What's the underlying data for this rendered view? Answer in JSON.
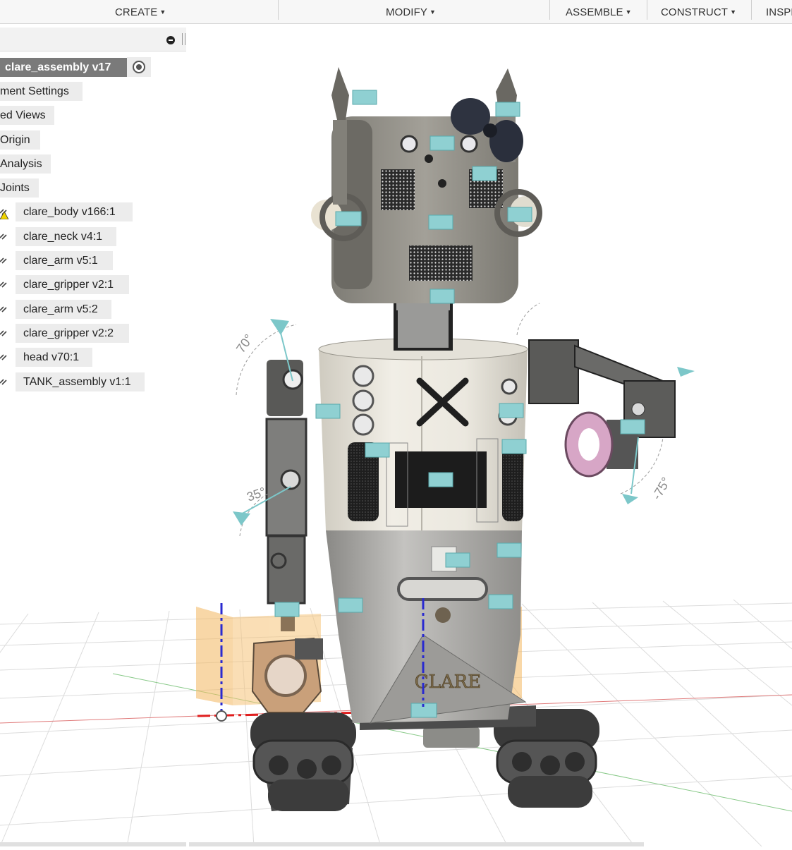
{
  "toolbar": {
    "create": "CREATE",
    "modify": "MODIFY",
    "assemble": "ASSEMBLE",
    "construct": "CONSTRUCT",
    "inspect": "INSPE"
  },
  "browser": {
    "root": "clare_assembly v17",
    "folders": [
      "ment Settings",
      "ed Views",
      "Origin",
      "Analysis",
      "Joints"
    ],
    "components": [
      "clare_body v166:1",
      "clare_neck v4:1",
      "clare_arm v5:1",
      "clare_gripper v2:1",
      "clare_arm v5:2",
      "clare_gripper v2:2",
      "head v70:1",
      "TANK_assembly v1:1"
    ]
  },
  "model": {
    "body_logo": "CLARE",
    "angle_labels": {
      "left_shoulder": "70°",
      "left_elbow": "35°",
      "right_wrist": "-75°"
    },
    "colors": {
      "body_top": "#e8e5dc",
      "body_bottom": "#a9a9a7",
      "head": "#8f8d86",
      "joint_gizmo": "#7cc7c9",
      "ground_plane": "#f4b860",
      "gripper_pink": "#d7a6c6",
      "gripper_orange": "#c9a07a"
    }
  },
  "icons": {
    "panel_collapse": "minus-circle-icon",
    "root_active": "radio-active-icon",
    "component": "link-icon",
    "body_warning": "warning-icon"
  }
}
